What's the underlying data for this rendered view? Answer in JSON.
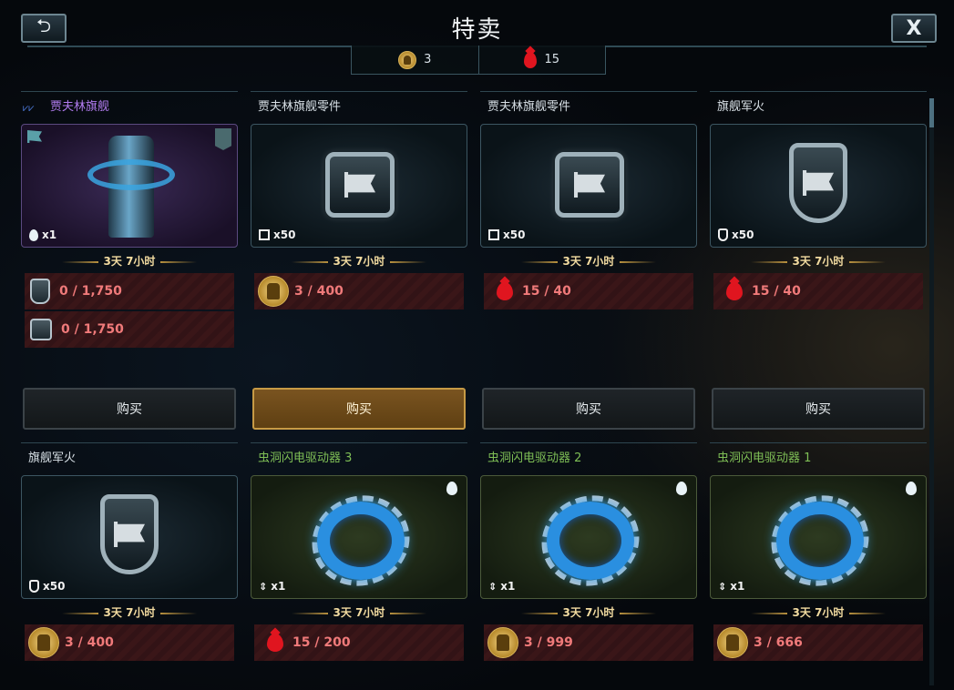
{
  "title": "特卖",
  "close_label": "X",
  "currency": {
    "coins": "3",
    "blood": "15"
  },
  "cards": [
    {
      "name": "贾夫林旗舰",
      "qty": "x1",
      "timer": "3天 7小时",
      "costs": [
        "0 / 1,750",
        "0 / 1,750"
      ],
      "buy": "购买"
    },
    {
      "name": "贾夫林旗舰零件",
      "qty": "x50",
      "timer": "3天 7小时",
      "costs": [
        "3 / 400"
      ],
      "buy": "购买"
    },
    {
      "name": "贾夫林旗舰零件",
      "qty": "x50",
      "timer": "3天 7小时",
      "costs": [
        "15 / 40"
      ],
      "buy": "购买"
    },
    {
      "name": "旗舰军火",
      "qty": "x50",
      "timer": "3天 7小时",
      "costs": [
        "15 / 40"
      ],
      "buy": "购买"
    },
    {
      "name": "旗舰军火",
      "qty": "x50",
      "timer": "3天 7小时",
      "costs": [
        "3 / 400"
      ]
    },
    {
      "name": "虫洞闪电驱动器 3",
      "qty": "x1",
      "timer": "3天 7小时",
      "costs": [
        "15 / 200"
      ]
    },
    {
      "name": "虫洞闪电驱动器 2",
      "qty": "x1",
      "timer": "3天 7小时",
      "costs": [
        "3 / 999"
      ]
    },
    {
      "name": "虫洞闪电驱动器 1",
      "qty": "x1",
      "timer": "3天 7小时",
      "costs": [
        "3 / 666"
      ]
    }
  ],
  "colors": {
    "accent": "#c79a45",
    "cost_text": "#f07a7a",
    "rare_name": "#b27cf0",
    "drive_name": "#7fbf56"
  },
  "scrollbar": {
    "thumb_fraction": 0.05
  }
}
